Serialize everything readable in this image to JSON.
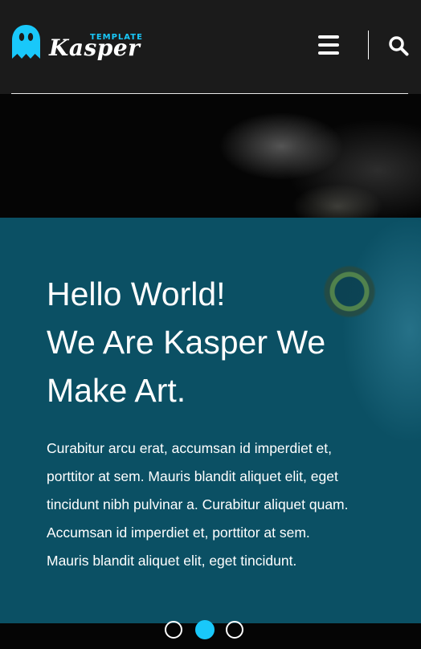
{
  "colors": {
    "accent": "#19c8fa",
    "overlay": "#0b5064",
    "header": "#1b1b1b"
  },
  "header": {
    "logo": {
      "tagline": "TEMPLATE",
      "name": "Kasper",
      "icon": "ghost-icon"
    },
    "menu_icon": "hamburger-menu-icon",
    "search_icon": "search-icon"
  },
  "hero": {
    "title_lines": [
      "Hello World!",
      "We Are Kasper We",
      "Make Art."
    ],
    "paragraph_lines": [
      "Curabitur arcu erat, accumsan id imperdiet et,",
      "porttitor at sem. Mauris blandit aliquet elit, eget",
      "tincidunt nibh pulvinar a. Curabitur aliquet quam.",
      "Accumsan id imperdiet et, porttitor at sem.",
      "Mauris blandit aliquet elit, eget tincidunt."
    ],
    "slider": {
      "count": 3,
      "active_index": 1
    }
  }
}
